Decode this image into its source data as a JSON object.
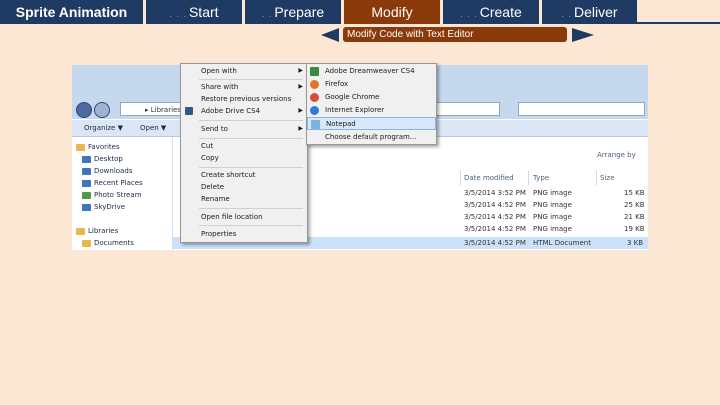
{
  "header": {
    "app_title": "Sprite Animation",
    "tabs": [
      {
        "label": "Start"
      },
      {
        "label": "Prepare"
      },
      {
        "label": "Modify"
      },
      {
        "label": "Create"
      },
      {
        "label": "Deliver"
      }
    ],
    "active_tab": "Modify",
    "subtitle": "Modify Code with Text Editor"
  },
  "colors": {
    "nav_blue": "#1f3b63",
    "active_brown": "#8a3a0a",
    "background": "#fbe7d4"
  },
  "explorer": {
    "address": "▸ Libraries ▸ ... ▸ sprite animation ▸ recycle",
    "toolbar": {
      "organize": "Organize ▼",
      "open": "Open ▼"
    },
    "nav_items": [
      "Favorites",
      "Desktop",
      "Downloads",
      "Recent Places",
      "Photo Stream",
      "SkyDrive",
      "Libraries",
      "Documents"
    ],
    "columns": [
      "Date modified",
      "Type",
      "Size"
    ],
    "arrange": "Arrange by",
    "rows": [
      {
        "date": "3/5/2014 3:52 PM",
        "type": "PNG image",
        "size": "15 KB"
      },
      {
        "date": "3/5/2014 4:52 PM",
        "type": "PNG image",
        "size": "25 KB"
      },
      {
        "date": "3/5/2014 4:52 PM",
        "type": "PNG image",
        "size": "21 KB"
      },
      {
        "date": "3/5/2014 4:52 PM",
        "type": "PNG image",
        "size": "19 KB"
      },
      {
        "date": "3/5/2014 4:52 PM",
        "type": "HTML Document",
        "size": "3 KB"
      }
    ]
  },
  "context_menu": {
    "items": [
      "Open with",
      "Share with",
      "Restore previous versions",
      "Adobe Drive CS4",
      "Send to",
      "Cut",
      "Copy",
      "Create shortcut",
      "Delete",
      "Rename",
      "Open file location",
      "Properties"
    ]
  },
  "open_with_menu": {
    "items": [
      "Adobe Dreamweaver CS4",
      "Firefox",
      "Google Chrome",
      "Internet Explorer",
      "Notepad",
      "Choose default program..."
    ],
    "highlighted": "Notepad"
  }
}
